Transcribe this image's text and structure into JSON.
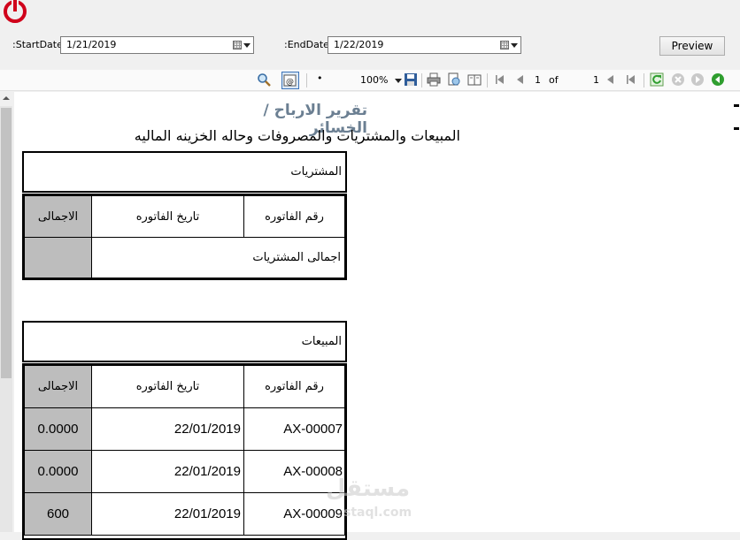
{
  "filters": {
    "start_label": ":StartDate",
    "start_value": "1/21/2019",
    "end_label": ":EndDate",
    "end_value": "1/22/2019",
    "preview_label": "Preview"
  },
  "toolbar": {
    "zoom": "100%",
    "page_current": "1",
    "page_of": "of",
    "page_total": "1",
    "bullet": "•"
  },
  "report": {
    "title": "تقرير الارباح / الخسائر",
    "subtitle": "المبيعات والمشتريات والمصروفات وحاله الخزينه الماليه",
    "purchases": {
      "heading": "المشتريات",
      "columns": {
        "invoice_no": "رقم الفاتوره",
        "invoice_date": "تاريخ الفاتوره",
        "total": "الاجمالى"
      },
      "total_label": "اجمالى  المشتريات",
      "total_value": ""
    },
    "sales": {
      "heading": "المبيعات",
      "columns": {
        "invoice_no": "رقم الفاتوره",
        "invoice_date": "تاريخ الفاتوره",
        "total": "الاجمالى"
      },
      "rows": [
        {
          "invoice_no": "AX-00007",
          "invoice_date": "22/01/2019",
          "total": "0.0000"
        },
        {
          "invoice_no": "AX-00008",
          "invoice_date": "22/01/2019",
          "total": "0.0000"
        },
        {
          "invoice_no": "AX-00009",
          "invoice_date": "22/01/2019",
          "total": "600"
        }
      ]
    }
  },
  "watermark": {
    "arabic": "مستقل",
    "latin": "staql.com"
  },
  "colors": {
    "power": "#d0021b",
    "title": "#6b7f92",
    "cell_gray": "#bdbdbd",
    "refresh_green": "#2f9e2f"
  }
}
